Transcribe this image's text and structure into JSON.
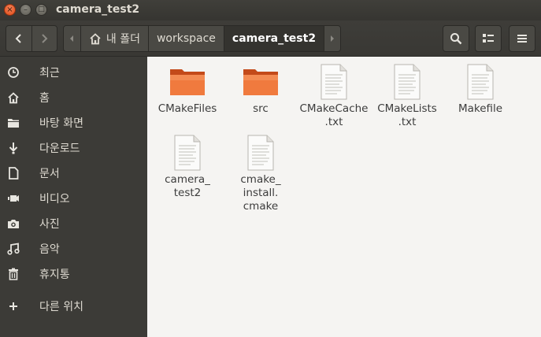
{
  "window": {
    "title": "camera_test2",
    "close_glyph": "×",
    "minimize_glyph": "–",
    "maximize_glyph": "□"
  },
  "path": {
    "home_label": "내 폴더",
    "segments": [
      "workspace",
      "camera_test2"
    ]
  },
  "sidebar": {
    "items": [
      {
        "label": "최근",
        "icon": "clock-icon"
      },
      {
        "label": "홈",
        "icon": "home-icon"
      },
      {
        "label": "바탕 화면",
        "icon": "folder-icon"
      },
      {
        "label": "다운로드",
        "icon": "download-icon"
      },
      {
        "label": "문서",
        "icon": "document-icon"
      },
      {
        "label": "비디오",
        "icon": "video-icon"
      },
      {
        "label": "사진",
        "icon": "camera-icon"
      },
      {
        "label": "음악",
        "icon": "music-icon"
      },
      {
        "label": "휴지통",
        "icon": "trash-icon"
      },
      {
        "label": "다른 위치",
        "icon": "plus-icon"
      }
    ]
  },
  "files": [
    {
      "name": "CMakeFiles",
      "kind": "folder"
    },
    {
      "name": "src",
      "kind": "folder"
    },
    {
      "name": "CMakeCache\n.txt",
      "kind": "document"
    },
    {
      "name": "CMakeLists\n.txt",
      "kind": "document"
    },
    {
      "name": "Makefile",
      "kind": "document"
    },
    {
      "name": "camera_\ntest2",
      "kind": "document"
    },
    {
      "name": "cmake_\ninstall.\ncmake",
      "kind": "document"
    }
  ],
  "colors": {
    "folder_orange": "#e9622c",
    "sidebar_bg": "#3c3b37",
    "content_bg": "#f5f4f2"
  }
}
